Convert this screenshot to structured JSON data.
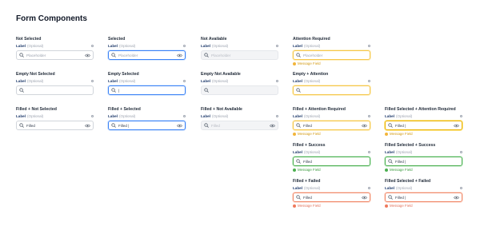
{
  "page": {
    "title": "Form Components"
  },
  "field": {
    "label": "Label",
    "optional": "(Optional)",
    "placeholder": "Placeholder",
    "filled_value": "Filled",
    "filled_selected_value": "Filled |",
    "selected_cursor": "|",
    "message": "Message Field"
  },
  "states": [
    {
      "id": "not-selected",
      "title": "Not Selected",
      "kind": "default",
      "value": "placeholder",
      "eye": true,
      "message": false
    },
    {
      "id": "selected",
      "title": "Selected",
      "kind": "selected",
      "value": "placeholder",
      "eye": true,
      "message": false
    },
    {
      "id": "not-available",
      "title": "Not Available",
      "kind": "disabled",
      "value": "placeholder",
      "eye": false,
      "message": false
    },
    {
      "id": "attention-required",
      "title": "Attention Required",
      "kind": "attention",
      "value": "placeholder",
      "eye": false,
      "message": "attention"
    },
    {
      "id": "empty-not-selected",
      "title": "Empty Not Selected",
      "kind": "default",
      "value": "empty",
      "eye": false,
      "message": false
    },
    {
      "id": "empty-selected",
      "title": "Empty Selected",
      "kind": "selected",
      "value": "cursor",
      "eye": false,
      "message": false
    },
    {
      "id": "empty-not-available",
      "title": "Empty Not Available",
      "kind": "disabled",
      "value": "empty",
      "eye": false,
      "message": false
    },
    {
      "id": "empty-attention",
      "title": "Empty + Attention",
      "kind": "attention",
      "value": "empty",
      "eye": false,
      "message": false
    },
    {
      "id": "filled-not-selected",
      "title": "Filled + Not Selected",
      "kind": "default",
      "value": "filled",
      "eye": true,
      "message": false
    },
    {
      "id": "filled-selected",
      "title": "Filled + Selected",
      "kind": "selected",
      "value": "filled_selected",
      "eye": true,
      "message": false
    },
    {
      "id": "filled-not-available",
      "title": "Filled + Not Available",
      "kind": "disabled",
      "value": "filled",
      "eye": true,
      "message": false
    },
    {
      "id": "filled-attention-required",
      "title": "Filled + Attention Required",
      "kind": "attention",
      "value": "filled",
      "eye": true,
      "message": "attention"
    },
    {
      "id": "filled-selected-attention-required",
      "title": "Filled Selected + Attention Required",
      "kind": "attsel",
      "value": "filled_selected",
      "eye": true,
      "message": "attention"
    },
    {
      "id": "filled-success",
      "title": "Filled + Success",
      "kind": "success",
      "value": "filled",
      "eye": false,
      "message": "success"
    },
    {
      "id": "filled-selected-success",
      "title": "Filled Selected + Success",
      "kind": "success",
      "value": "filled_selected",
      "eye": false,
      "message": "success"
    },
    {
      "id": "filled-failed",
      "title": "Filled + Failed",
      "kind": "failed",
      "value": "filled",
      "eye": true,
      "message": "failed"
    },
    {
      "id": "filled-selected-failed",
      "title": "Filled Selected + Failed",
      "kind": "failed",
      "value": "filled_selected",
      "eye": true,
      "message": "failed"
    }
  ],
  "icons": {
    "search": "search-icon",
    "eye": "eye-icon",
    "info": "info-icon",
    "status": "status-dot-icon"
  },
  "colors": {
    "selected": "#3b82f6",
    "attention": "#f5c64a",
    "success": "#4caf50",
    "failed": "#f08a6b",
    "label": "#1e3a6b"
  }
}
